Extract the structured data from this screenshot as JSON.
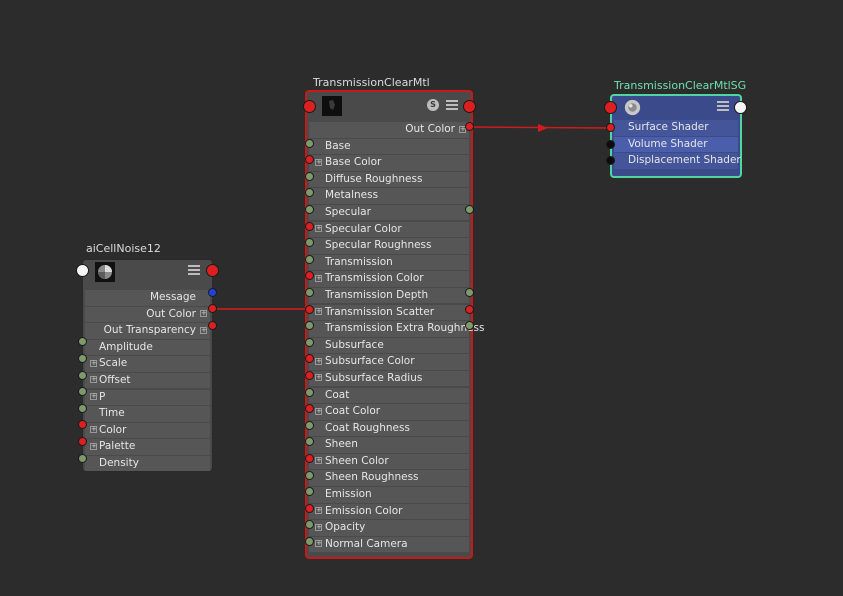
{
  "nodes": {
    "cellnoise": {
      "title": "aiCellNoise12",
      "outputs": [
        "Message",
        "Out Color",
        "Out Transparency"
      ],
      "inputs": [
        "Amplitude",
        "Scale",
        "Offset",
        "P",
        "Time",
        "Color",
        "Palette",
        "Density"
      ]
    },
    "material": {
      "title": "TransmissionClearMtl",
      "s_badge": "S",
      "output": "Out Color",
      "inputs": [
        "Base",
        "Base Color",
        "Diffuse Roughness",
        "Metalness",
        "Specular",
        "Specular Color",
        "Specular Roughness",
        "Transmission",
        "Transmission Color",
        "Transmission Depth",
        "Transmission Scatter",
        "Transmission Extra Roughness",
        "Subsurface",
        "Subsurface Color",
        "Subsurface Radius",
        "Coat",
        "Coat Color",
        "Coat Roughness",
        "Sheen",
        "Sheen Color",
        "Sheen Roughness",
        "Emission",
        "Emission Color",
        "Opacity",
        "Normal Camera"
      ]
    },
    "shading_group": {
      "title": "TransmissionClearMtlSG",
      "inputs": [
        "Surface Shader",
        "Volume Shader",
        "Displacement Shader"
      ]
    }
  },
  "icons": [
    "cellnoise-thumbnail-icon",
    "material-thumbnail-icon",
    "shading-group-sphere-icon",
    "attribute-menu-icon",
    "expand-plus-icon",
    "connection-arrow-icon"
  ],
  "colors": {
    "background": "#2c2c2c",
    "node_body": "#4a4a4a",
    "selected_border": "#c81818",
    "sg_body": "#3a4a8a",
    "sg_border": "#4fd6a0",
    "sg_title": "#6fe0b2",
    "wire": "#d21c1c",
    "port_red": "#dd1f1f",
    "port_green": "#7f9a6a",
    "port_blue": "#2440d8"
  }
}
